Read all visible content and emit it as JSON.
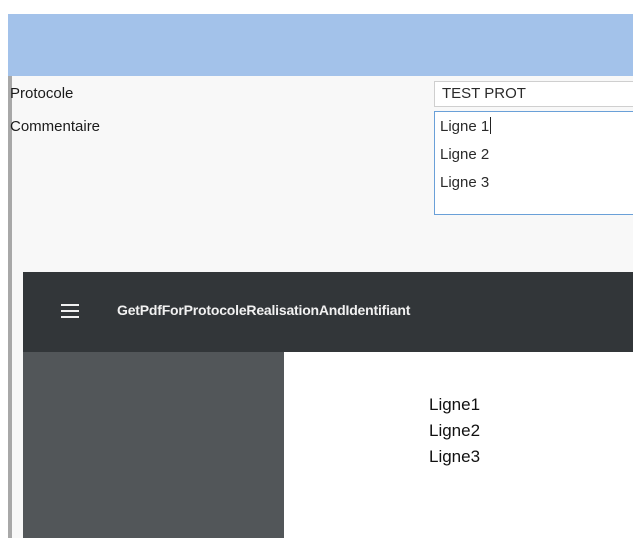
{
  "form": {
    "protocole_label": "Protocole",
    "protocole_value": "TEST PROT",
    "commentaire_label": "Commentaire",
    "commentaire_lines": [
      "Ligne 1",
      "Ligne 2",
      "Ligne 3"
    ]
  },
  "pdf_viewer": {
    "menu_icon": "hamburger-menu-icon",
    "title": "GetPdfForProtocoleRealisationAndIdentifiant",
    "content_lines": [
      "Ligne1",
      "Ligne2",
      "Ligne3"
    ]
  },
  "colors": {
    "title_band": "#a3c2ea",
    "toolbar": "#323639",
    "sidebar": "#525659",
    "focus_border": "#6aa0d8"
  }
}
